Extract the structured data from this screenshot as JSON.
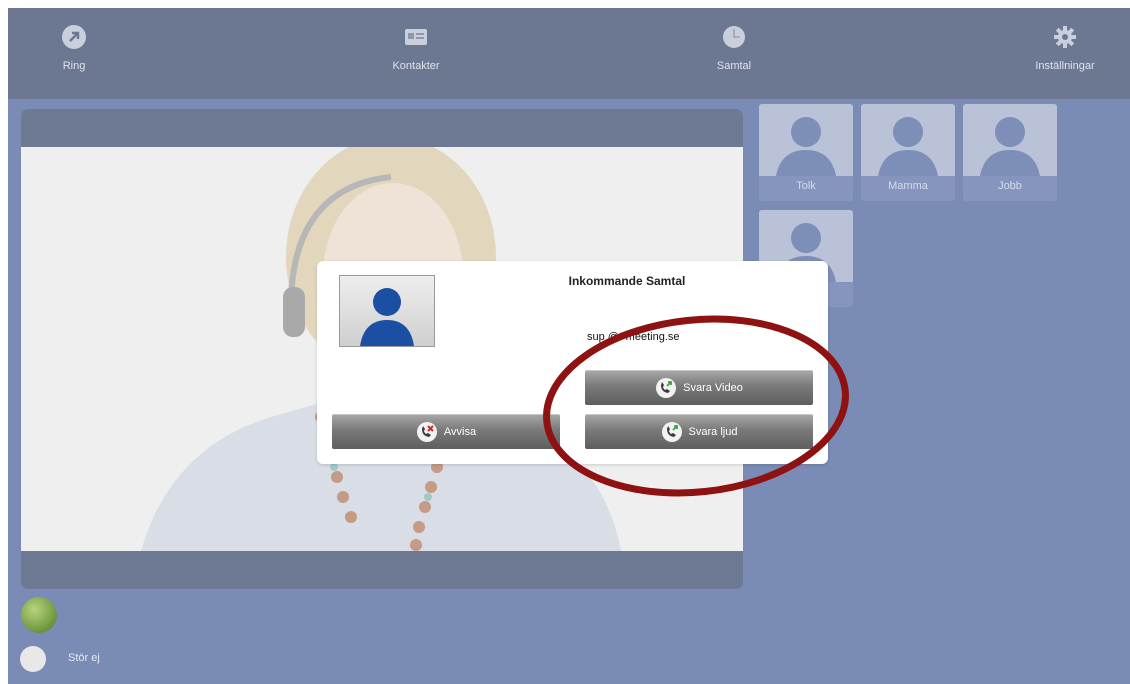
{
  "nav": {
    "ring": {
      "label": "Ring",
      "icon": "arrow-call-icon"
    },
    "kontakter": {
      "label": "Kontakter",
      "icon": "contact-card-icon"
    },
    "samtal": {
      "label": "Samtal",
      "icon": "clock-icon"
    },
    "settings": {
      "label": "Inställningar",
      "icon": "gear-icon"
    }
  },
  "contacts": [
    {
      "name": "Tolk"
    },
    {
      "name": "Mamma"
    },
    {
      "name": "Jobb"
    },
    {
      "name": ""
    }
  ],
  "status": {
    "dnd_label": "Stör ej"
  },
  "dialog": {
    "title": "Inkommande Samtal",
    "caller": "sup     @t-meeting.se",
    "answer_video": "Svara Video",
    "answer_audio": "Svara ljud",
    "reject": "Avvisa"
  },
  "colors": {
    "app_bg": "#7a8cb5",
    "topbar": "#6c7792",
    "annotation": "#8e1212"
  }
}
